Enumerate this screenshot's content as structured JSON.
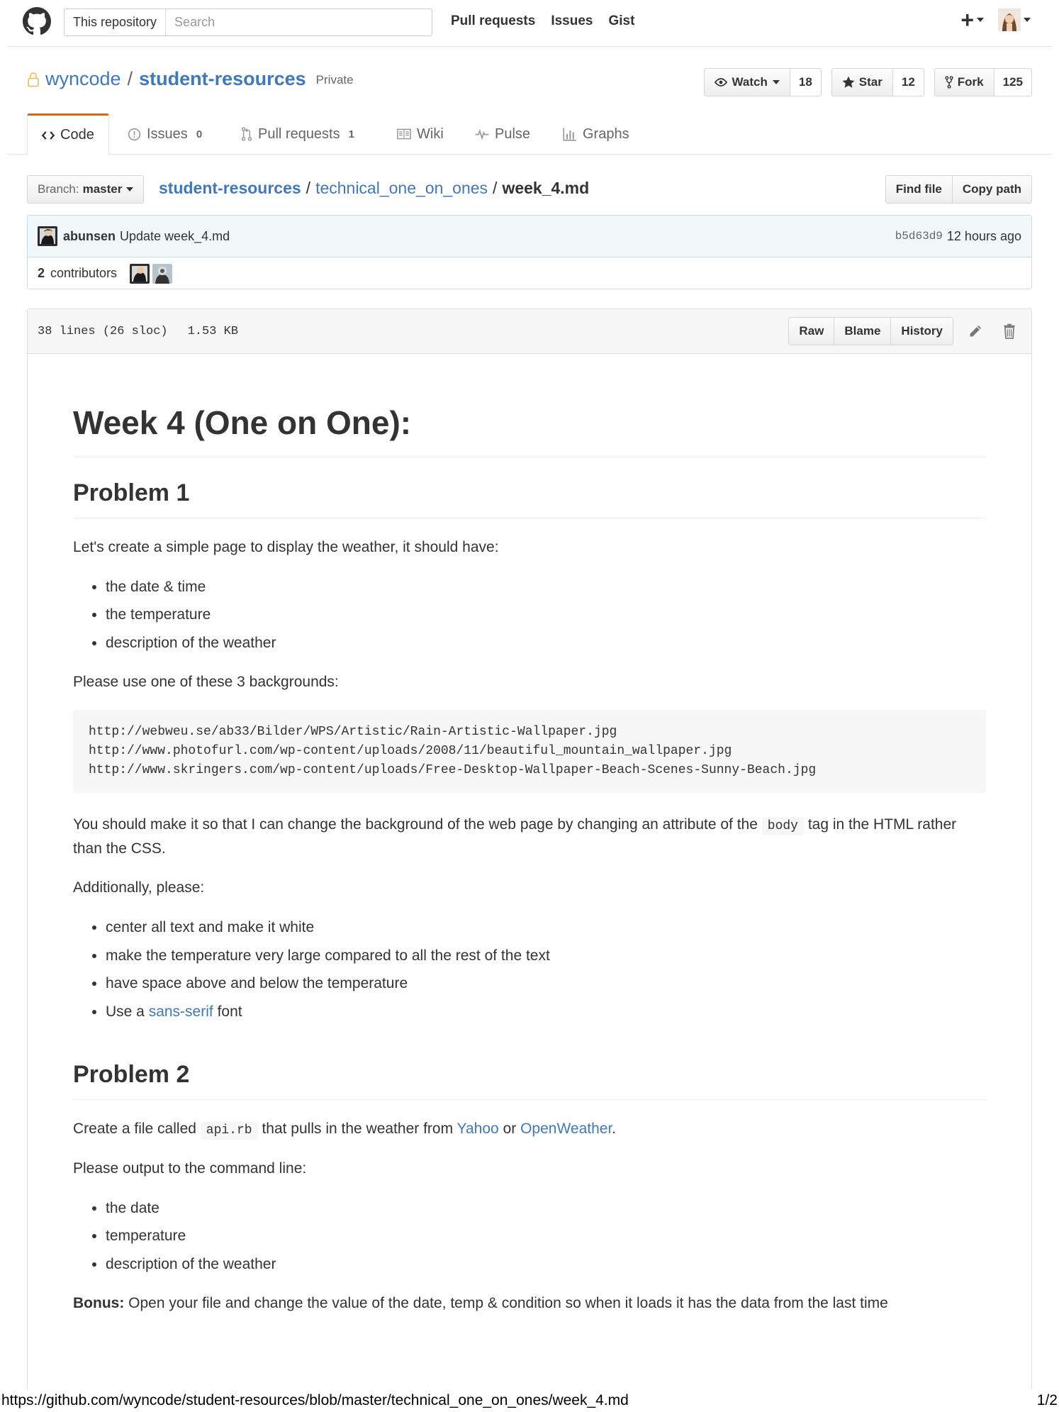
{
  "header": {
    "search_scope": "This repository",
    "search_placeholder": "Search",
    "nav": [
      "Pull requests",
      "Issues",
      "Gist"
    ],
    "plus_label": "+"
  },
  "repo": {
    "owner": "wyncode",
    "separator": "/",
    "name": "student-resources",
    "visibility": "Private",
    "watch_label": "Watch",
    "watch_count": "18",
    "star_label": "Star",
    "star_count": "12",
    "fork_label": "Fork",
    "fork_count": "125"
  },
  "tabs": {
    "code": "Code",
    "issues": "Issues",
    "issues_count": "0",
    "pulls": "Pull requests",
    "pulls_count": "1",
    "wiki": "Wiki",
    "pulse": "Pulse",
    "graphs": "Graphs"
  },
  "file_nav": {
    "branch_label": "Branch:",
    "branch_name": "master",
    "breadcrumb_root": "student-resources",
    "sep": "/",
    "breadcrumb_dir": "technical_one_on_ones",
    "breadcrumb_file": "week_4.md",
    "find_file": "Find file",
    "copy_path": "Copy path"
  },
  "commit": {
    "author": "abunsen",
    "message": "Update week_4.md",
    "sha": "b5d63d9",
    "when": "12 hours ago",
    "contributors_count": "2",
    "contributors_label": "contributors"
  },
  "file": {
    "lines": "38 lines (26 sloc)",
    "size": "1.53 KB",
    "raw": "Raw",
    "blame": "Blame",
    "history": "History"
  },
  "content": {
    "h1": "Week 4 (One on One):",
    "problem1": {
      "title": "Problem 1",
      "intro": "Let's create a simple page to display the weather, it should have:",
      "items": [
        "the date & time",
        "the temperature",
        "description of the weather"
      ],
      "bg_intro": "Please use one of these 3 backgrounds:",
      "urls": [
        "http://webweu.se/ab33/Bilder/WPS/Artistic/Rain-Artistic-Wallpaper.jpg",
        "http://www.photofurl.com/wp-content/uploads/2008/11/beautiful_mountain_wallpaper.jpg",
        "http://www.skringers.com/wp-content/uploads/Free-Desktop-Wallpaper-Beach-Scenes-Sunny-Beach.jpg"
      ],
      "body_pre": "You should make it so that I can change the background of the web page by changing an attribute of the",
      "body_code": "body",
      "body_post": "tag in the HTML rather than the CSS.",
      "additionally": "Additionally, please:",
      "extra_items": [
        "center all text and make it white",
        "make the temperature very large compared to all the rest of the text",
        "have space above and below the temperature"
      ],
      "font_pre": "Use a",
      "font_link": "sans-serif",
      "font_post": "font"
    },
    "problem2": {
      "title": "Problem 2",
      "p_pre": "Create a file called",
      "p_code": "api.rb",
      "p_mid": "that pulls in the weather from",
      "link_yahoo": "Yahoo",
      "p_or": "or",
      "link_ow": "OpenWeather",
      "p_end": ".",
      "output_intro": "Please output to the command line:",
      "items": [
        "the date",
        "temperature",
        "description of the weather"
      ],
      "bonus_label": "Bonus:",
      "bonus_text": "Open your file and change the value of the date, temp & condition so when it loads it has the data from the last time"
    }
  },
  "footer": {
    "url": "https://github.com/wyncode/student-resources/blob/master/technical_one_on_ones/week_4.md",
    "page": "1/2"
  },
  "colors": {
    "link": "#4078c0",
    "tab_accent": "#d26911",
    "commit_bg": "#f2f8fa"
  }
}
